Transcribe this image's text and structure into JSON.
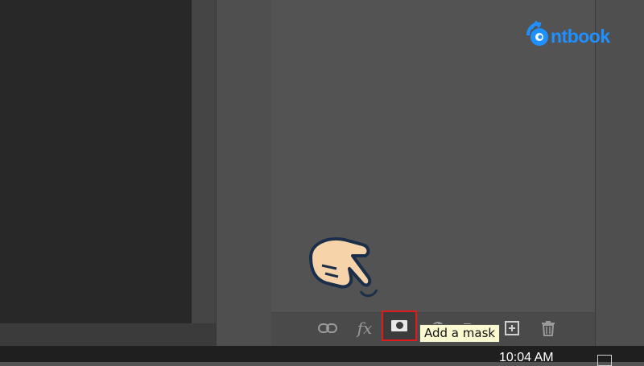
{
  "layers_panel": {
    "footer_icons": [
      {
        "name": "link-layers-icon"
      },
      {
        "name": "fx-icon",
        "label": "fx"
      },
      {
        "name": "add-mask-icon"
      },
      {
        "name": "adjustment-layer-icon"
      },
      {
        "name": "group-icon"
      },
      {
        "name": "new-layer-icon"
      },
      {
        "name": "delete-icon"
      }
    ]
  },
  "tooltip": {
    "text": "Add a mask"
  },
  "taskbar": {
    "clock": "10:04 AM"
  },
  "watermark": {
    "brand": "ntbook",
    "color": "#1e90ff"
  },
  "highlight": {
    "color": "#e01b1b"
  },
  "colors": {
    "canvas": "#282828",
    "panel": "#535353",
    "tooltip_bg": "#fbf9cf"
  }
}
